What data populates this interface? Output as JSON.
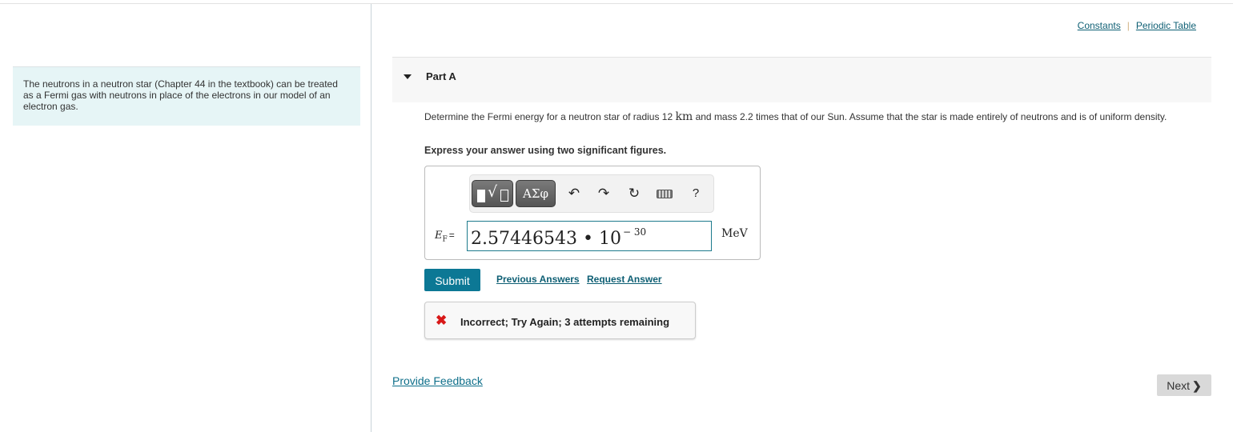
{
  "intro_text": "The neutrons in a neutron star (Chapter 44 in the textbook) can be treated as a Fermi gas with neutrons in place of the electrons in our model of an electron gas.",
  "top_links": {
    "constants": "Constants",
    "separator": "|",
    "periodic_table": "Periodic Table"
  },
  "part": {
    "title": "Part A",
    "expanded_icon": "triangle-down-icon"
  },
  "question": {
    "before_unit": "Determine the Fermi energy for a neutron star of radius 12 ",
    "unit": "km",
    "after_unit": " and mass 2.2 times that of our Sun. Assume that the star is made entirely of neutrons and is of uniform density.",
    "instruction": "Express your answer using two significant figures."
  },
  "toolbar": {
    "templates_icon": "math-templates-icon",
    "greek_label": "ΑΣφ",
    "undo_icon": "↶",
    "redo_icon": "↷",
    "reset_icon": "↻",
    "keyboard_icon": "keyboard-icon",
    "help_label": "?"
  },
  "answer": {
    "variable": "E",
    "subscript": "F",
    "equals": "=",
    "mantissa": "2.57446543",
    "times": "•",
    "base": "10",
    "exponent": "− 30",
    "unit": "MeV"
  },
  "actions": {
    "submit": "Submit",
    "previous_answers": "Previous Answers",
    "request_answer": "Request Answer"
  },
  "feedback": {
    "icon": "✖",
    "message": "Incorrect; Try Again; 3 attempts remaining",
    "status_color": "#d81818"
  },
  "footer": {
    "provide_feedback": "Provide Feedback",
    "next": "Next",
    "next_icon": "❯"
  }
}
